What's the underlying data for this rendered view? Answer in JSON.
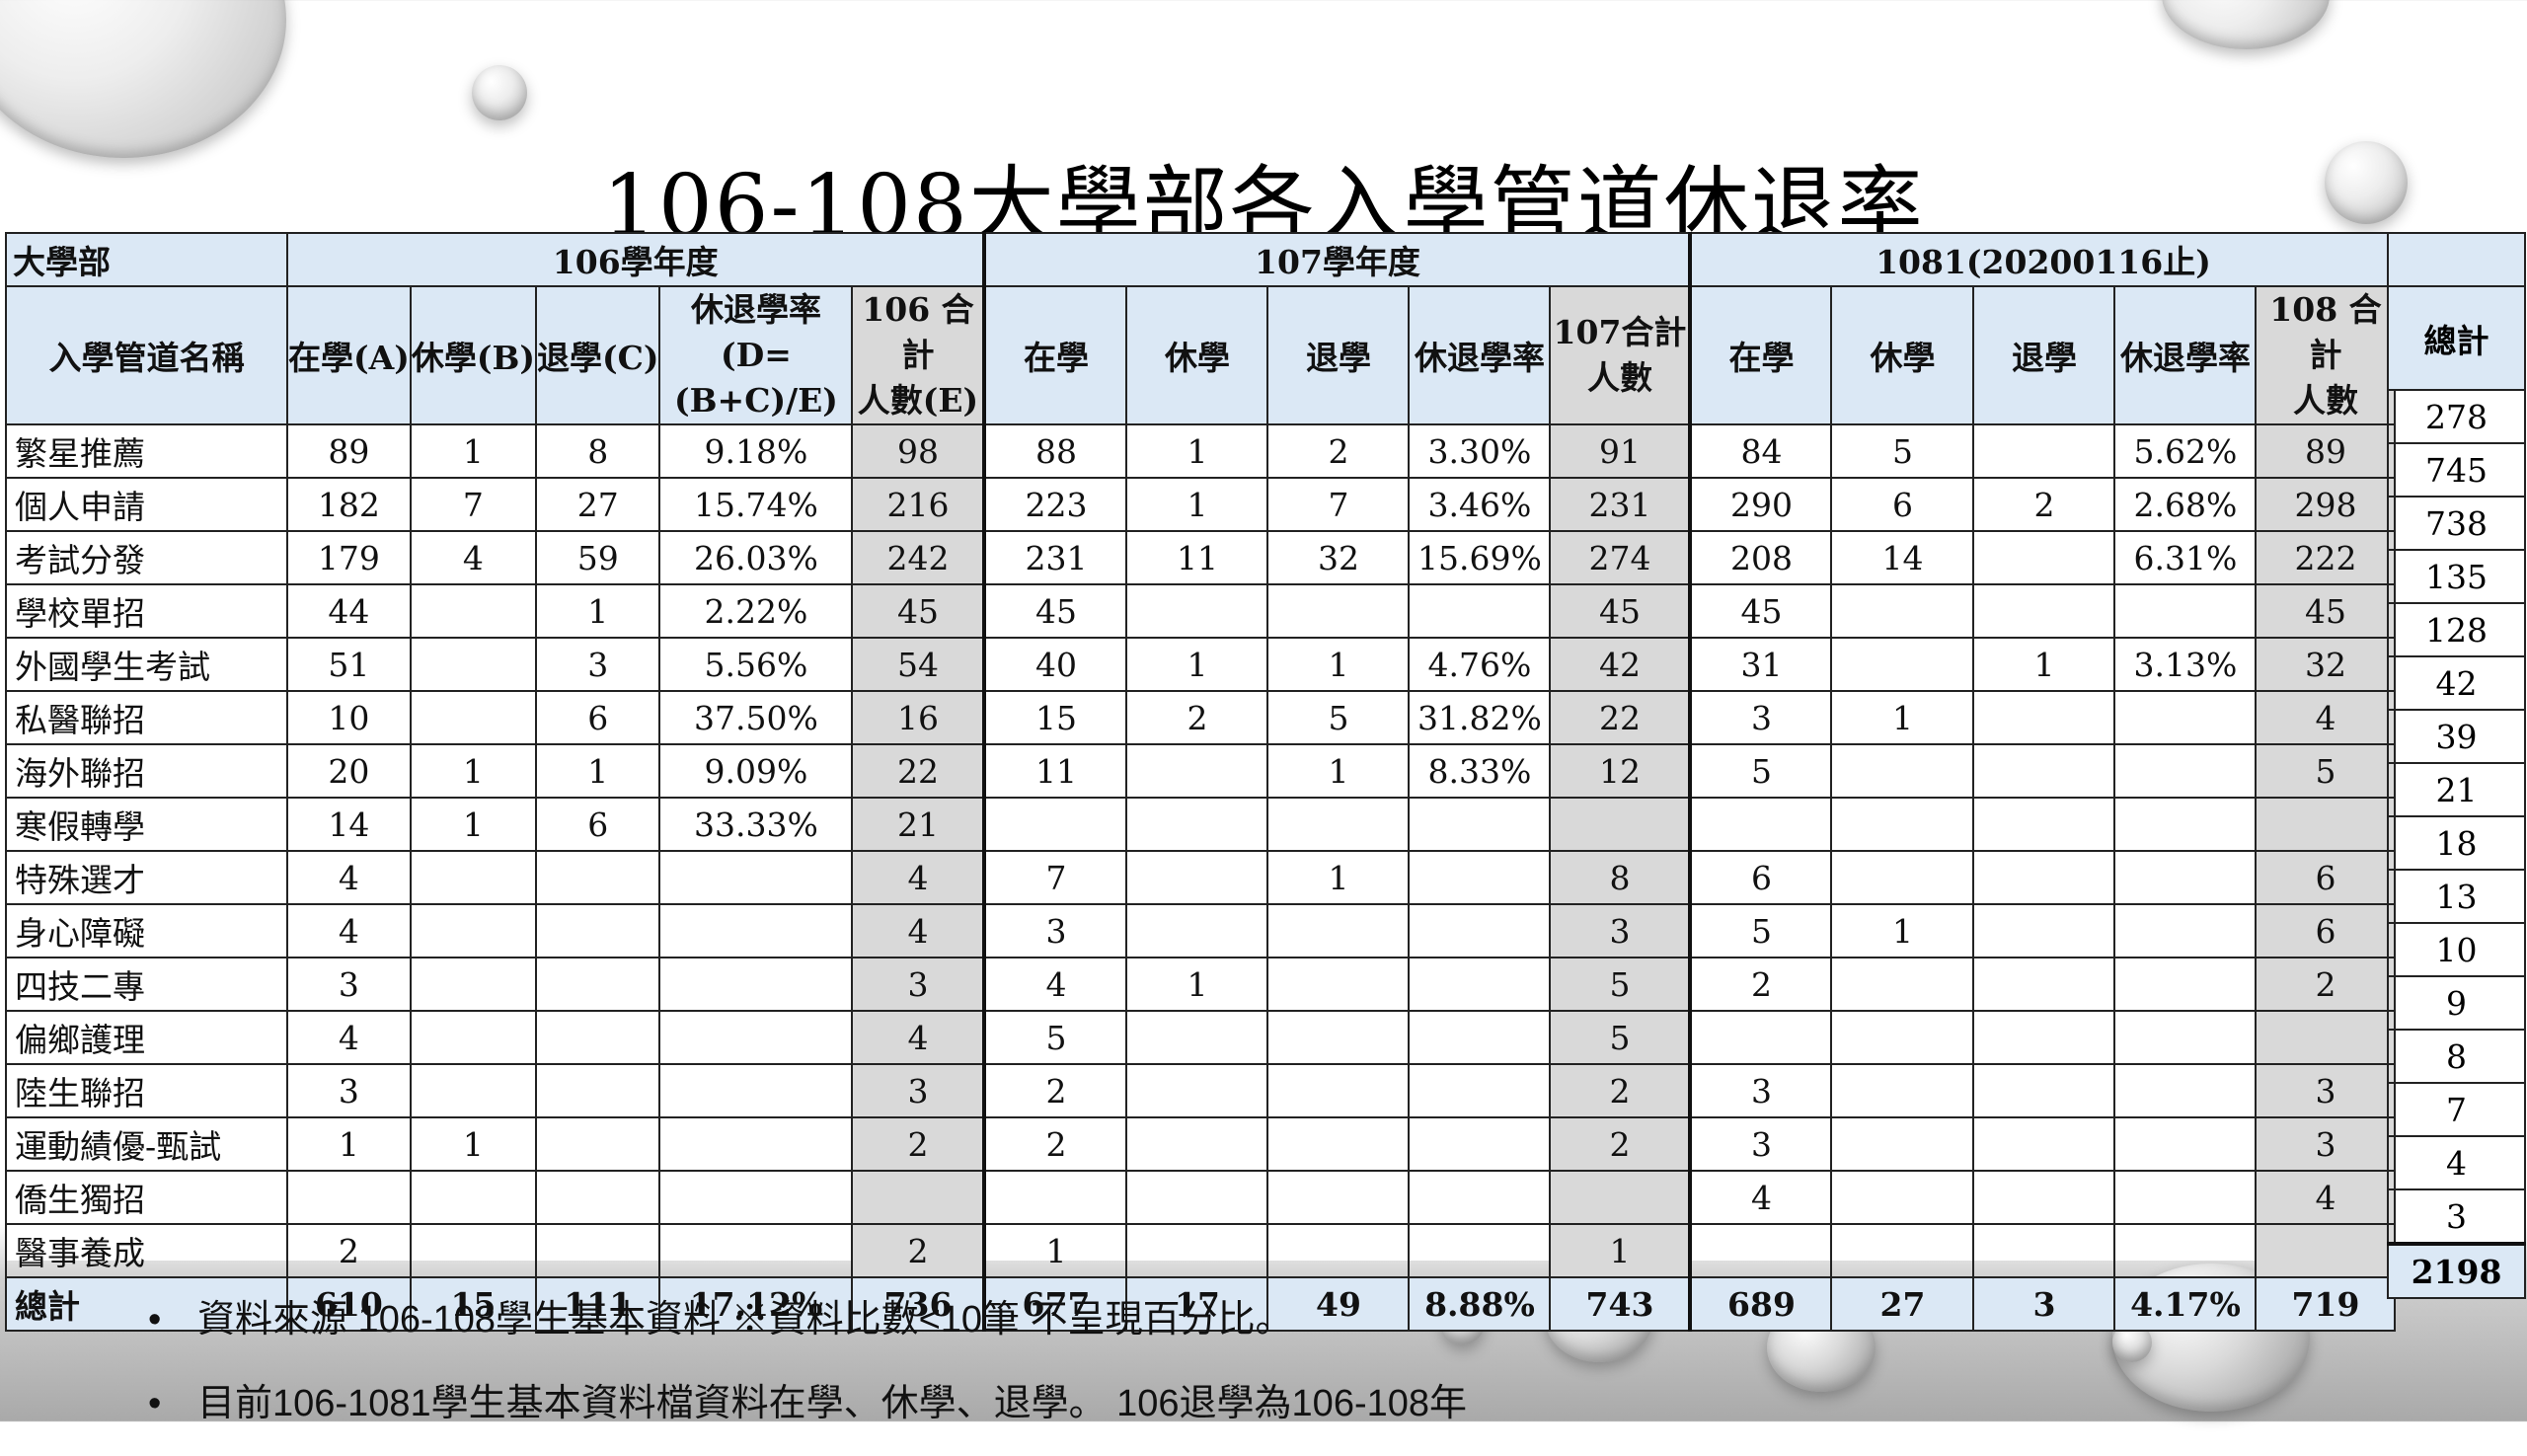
{
  "title": "106-108大學部各入學管道休退率",
  "table": {
    "corner_label": "大學部",
    "name_header": "入學管道名稱",
    "year_groups": [
      "106學年度",
      "107學年度",
      "1081(20200116止)"
    ],
    "total_header": "總計",
    "subheaders": {
      "y106": [
        "在學(A)",
        "休學(B)",
        "退學(C)",
        "休退學率|(D=(B+C)/E)",
        "106 合計|人數(E)"
      ],
      "y107": [
        "在學",
        "休學",
        "退學",
        "休退學率",
        "107合計|人數"
      ],
      "y108": [
        "在學",
        "休學",
        "退學",
        "休退學率",
        "108 合計|人數"
      ]
    },
    "rows": [
      {
        "name": "繁星推薦",
        "c": [
          "89",
          "1",
          "8",
          "9.18%",
          "98",
          "88",
          "1",
          "2",
          "3.30%",
          "91",
          "84",
          "5",
          "",
          "5.62%",
          "89"
        ],
        "total": "278"
      },
      {
        "name": "個人申請",
        "c": [
          "182",
          "7",
          "27",
          "15.74%",
          "216",
          "223",
          "1",
          "7",
          "3.46%",
          "231",
          "290",
          "6",
          "2",
          "2.68%",
          "298"
        ],
        "total": "745"
      },
      {
        "name": "考試分發",
        "c": [
          "179",
          "4",
          "59",
          "26.03%",
          "242",
          "231",
          "11",
          "32",
          "15.69%",
          "274",
          "208",
          "14",
          "",
          "6.31%",
          "222"
        ],
        "total": "738"
      },
      {
        "name": "學校單招",
        "c": [
          "44",
          "",
          "1",
          "2.22%",
          "45",
          "45",
          "",
          "",
          "",
          "45",
          "45",
          "",
          "",
          "",
          "45"
        ],
        "total": "135"
      },
      {
        "name": "外國學生考試",
        "c": [
          "51",
          "",
          "3",
          "5.56%",
          "54",
          "40",
          "1",
          "1",
          "4.76%",
          "42",
          "31",
          "",
          "1",
          "3.13%",
          "32"
        ],
        "total": "128"
      },
      {
        "name": "私醫聯招",
        "c": [
          "10",
          "",
          "6",
          "37.50%",
          "16",
          "15",
          "2",
          "5",
          "31.82%",
          "22",
          "3",
          "1",
          "",
          "",
          "4"
        ],
        "total": "42"
      },
      {
        "name": "海外聯招",
        "c": [
          "20",
          "1",
          "1",
          "9.09%",
          "22",
          "11",
          "",
          "1",
          "8.33%",
          "12",
          "5",
          "",
          "",
          "",
          "5"
        ],
        "total": "39"
      },
      {
        "name": "寒假轉學",
        "c": [
          "14",
          "1",
          "6",
          "33.33%",
          "21",
          "",
          "",
          "",
          "",
          "",
          "",
          "",
          "",
          "",
          ""
        ],
        "total": "21"
      },
      {
        "name": "特殊選才",
        "c": [
          "4",
          "",
          "",
          "",
          "4",
          "7",
          "",
          "1",
          "",
          "8",
          "6",
          "",
          "",
          "",
          "6"
        ],
        "total": "18"
      },
      {
        "name": "身心障礙",
        "c": [
          "4",
          "",
          "",
          "",
          "4",
          "3",
          "",
          "",
          "",
          "3",
          "5",
          "1",
          "",
          "",
          "6"
        ],
        "total": "13"
      },
      {
        "name": "四技二專",
        "c": [
          "3",
          "",
          "",
          "",
          "3",
          "4",
          "1",
          "",
          "",
          "5",
          "2",
          "",
          "",
          "",
          "2"
        ],
        "total": "10"
      },
      {
        "name": "偏鄉護理",
        "c": [
          "4",
          "",
          "",
          "",
          "4",
          "5",
          "",
          "",
          "",
          "5",
          "",
          "",
          "",
          "",
          ""
        ],
        "total": "9"
      },
      {
        "name": "陸生聯招",
        "c": [
          "3",
          "",
          "",
          "",
          "3",
          "2",
          "",
          "",
          "",
          "2",
          "3",
          "",
          "",
          "",
          "3"
        ],
        "total": "8"
      },
      {
        "name": "運動績優-甄試",
        "c": [
          "1",
          "1",
          "",
          "",
          "2",
          "2",
          "",
          "",
          "",
          "2",
          "3",
          "",
          "",
          "",
          "3"
        ],
        "total": "7"
      },
      {
        "name": "僑生獨招",
        "c": [
          "",
          "",
          "",
          "",
          "",
          "",
          "",
          "",
          "",
          "",
          "4",
          "",
          "",
          "",
          "4"
        ],
        "total": "4"
      },
      {
        "name": "醫事養成",
        "c": [
          "2",
          "",
          "",
          "",
          "2",
          "1",
          "",
          "",
          "",
          "1",
          "",
          "",
          "",
          "",
          ""
        ],
        "total": "3"
      }
    ],
    "total_row": {
      "name": "總計",
      "c": [
        "610",
        "15",
        "111",
        "17.12%",
        "736",
        "677",
        "17",
        "49",
        "8.88%",
        "743",
        "689",
        "27",
        "3",
        "4.17%",
        "719"
      ],
      "total": "2198"
    }
  },
  "notes": [
    "資料來源 106-108學生基本資料   ※資料比數<10筆 不呈現百分比。",
    "目前106-1081學生基本資料檔資料在學、休學、退學。 106退學為106-108年"
  ]
}
